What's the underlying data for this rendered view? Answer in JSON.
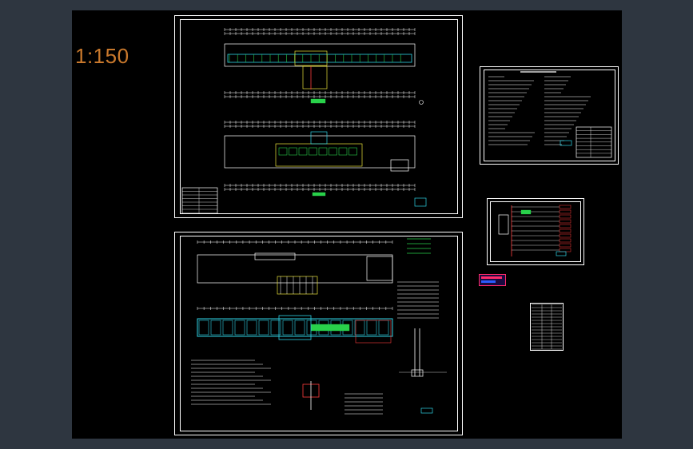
{
  "viewport": {
    "scale_text": "1:150"
  },
  "colors": {
    "outer_bg": "#2e3640",
    "canvas_bg": "#000000",
    "scale_text": "#c8782c",
    "line_white": "#ffffff",
    "line_green": "#29d14a",
    "line_cyan": "#2fd3e6",
    "line_red": "#ff3b3b",
    "line_yellow": "#e8e23a"
  },
  "sheets": [
    {
      "name": "floor-plans-sheet"
    },
    {
      "name": "foundation-sheet"
    },
    {
      "name": "design-notes-sheet"
    },
    {
      "name": "system-diagram-sheet"
    },
    {
      "name": "material-table-sheet"
    }
  ]
}
